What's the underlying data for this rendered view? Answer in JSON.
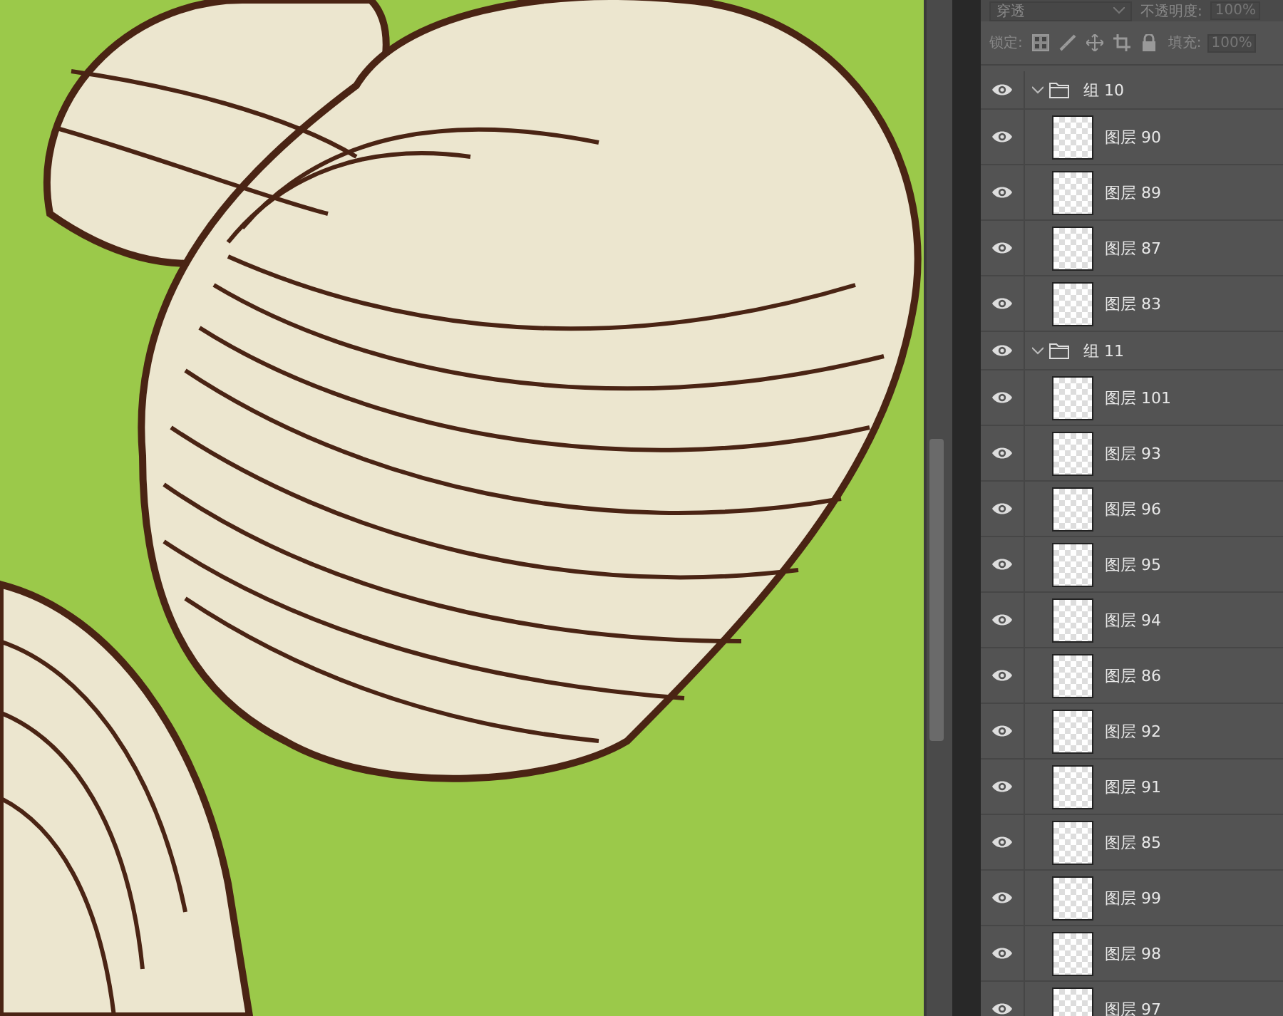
{
  "options_bar": {
    "blend_mode": "穿透",
    "opacity_label": "不透明度:",
    "opacity_value": "100%",
    "lock_label": "锁定:",
    "fill_label": "填充:",
    "fill_value": "100%"
  },
  "layers": [
    {
      "kind": "group",
      "name": "组 10",
      "visible": true,
      "expanded": true,
      "children": [
        {
          "kind": "layer",
          "name": "图层 90",
          "visible": true
        },
        {
          "kind": "layer",
          "name": "图层 89",
          "visible": true
        },
        {
          "kind": "layer",
          "name": "图层 87",
          "visible": true
        },
        {
          "kind": "layer",
          "name": "图层 83",
          "visible": true
        }
      ]
    },
    {
      "kind": "group",
      "name": "组 11",
      "visible": true,
      "expanded": true,
      "children": [
        {
          "kind": "layer",
          "name": "图层 101",
          "visible": true
        },
        {
          "kind": "layer",
          "name": "图层 93",
          "visible": true
        },
        {
          "kind": "layer",
          "name": "图层 96",
          "visible": true
        },
        {
          "kind": "layer",
          "name": "图层 95",
          "visible": true
        },
        {
          "kind": "layer",
          "name": "图层 94",
          "visible": true
        },
        {
          "kind": "layer",
          "name": "图层 86",
          "visible": true
        },
        {
          "kind": "layer",
          "name": "图层 92",
          "visible": true
        },
        {
          "kind": "layer",
          "name": "图层 91",
          "visible": true
        },
        {
          "kind": "layer",
          "name": "图层 85",
          "visible": true
        },
        {
          "kind": "layer",
          "name": "图层 99",
          "visible": true
        },
        {
          "kind": "layer",
          "name": "图层 98",
          "visible": true
        },
        {
          "kind": "layer",
          "name": "图层 97",
          "visible": true
        }
      ]
    }
  ]
}
